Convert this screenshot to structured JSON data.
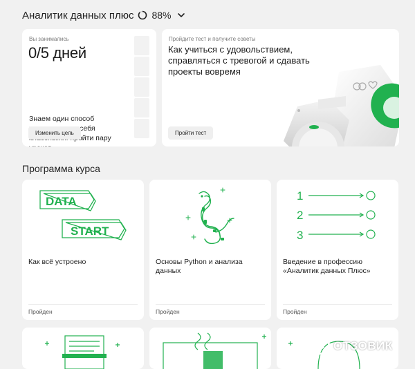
{
  "header": {
    "title": "Аналитик данных плюс",
    "progress_percent": "88%",
    "progress_fraction": 0.88
  },
  "progress_card": {
    "label": "Вы занимались",
    "days": "0/5 дней",
    "tip": "Знаем один способ почувствовать себя классными: пройти пару уроков",
    "button": "Изменить цель"
  },
  "test_card": {
    "label": "Пройдите тест и получите советы",
    "title": "Как учиться с удовольствием, справляться с тревогой и сдавать проекты вовремя",
    "button": "Пройти тест"
  },
  "program": {
    "title": "Программа курса",
    "courses": [
      {
        "title": "Как всё устроено",
        "status": "Пройден",
        "art_words": [
          "DATA",
          "START"
        ]
      },
      {
        "title": "Основы Python и анализа данных",
        "status": "Пройден"
      },
      {
        "title": "Введение в профессию «Аналитик данных Плюс»",
        "status": "Пройден",
        "art_numbers": [
          "1",
          "2",
          "3"
        ]
      }
    ]
  },
  "watermark": "ОТЗОВИК",
  "colors": {
    "accent": "#21b14f",
    "background": "#f1f1f1",
    "card": "#ffffff"
  }
}
